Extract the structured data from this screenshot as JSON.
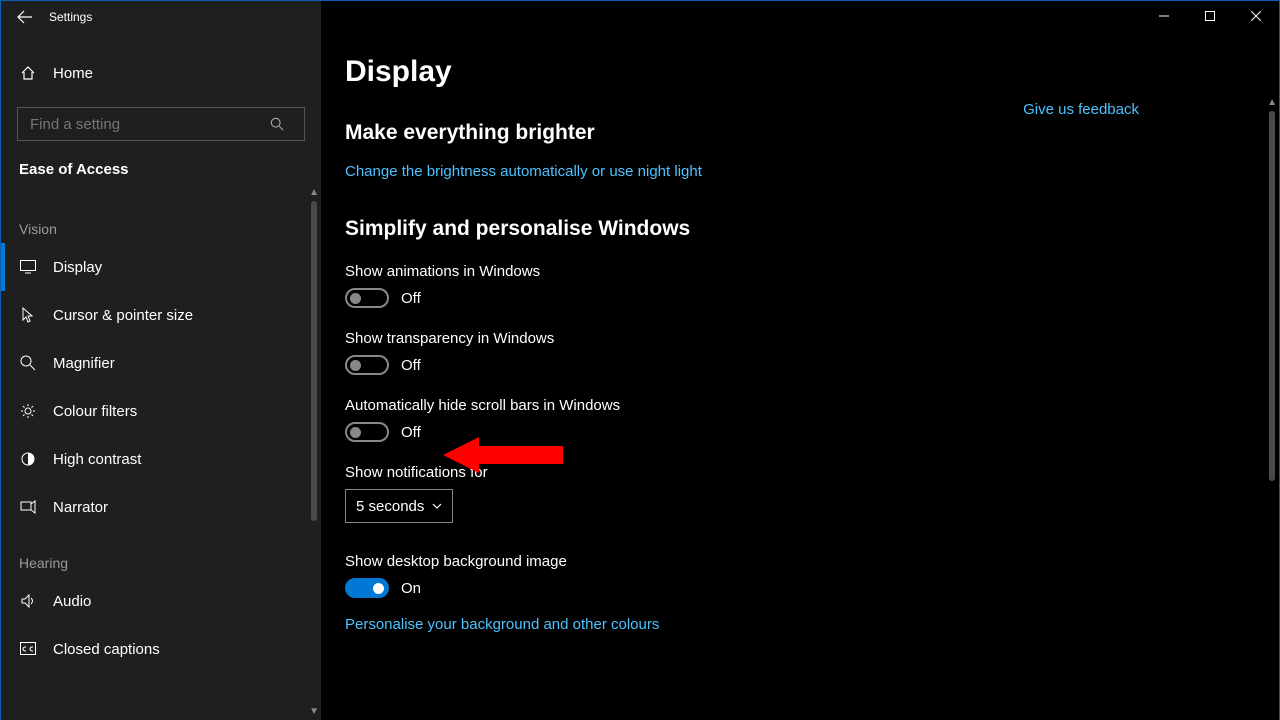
{
  "window": {
    "title": "Settings"
  },
  "sidebar": {
    "home": "Home",
    "search_placeholder": "Find a setting",
    "section": "Ease of Access",
    "groups": [
      {
        "label": "Vision",
        "items": [
          {
            "icon": "display-icon",
            "label": "Display",
            "selected": true
          },
          {
            "icon": "cursor-icon",
            "label": "Cursor & pointer size",
            "selected": false
          },
          {
            "icon": "magnifier-icon",
            "label": "Magnifier",
            "selected": false
          },
          {
            "icon": "colour-filters-icon",
            "label": "Colour filters",
            "selected": false
          },
          {
            "icon": "high-contrast-icon",
            "label": "High contrast",
            "selected": false
          },
          {
            "icon": "narrator-icon",
            "label": "Narrator",
            "selected": false
          }
        ]
      },
      {
        "label": "Hearing",
        "items": [
          {
            "icon": "audio-icon",
            "label": "Audio",
            "selected": false
          },
          {
            "icon": "closed-captions-icon",
            "label": "Closed captions",
            "selected": false
          }
        ]
      }
    ]
  },
  "main": {
    "title": "Display",
    "feedback_link": "Give us feedback",
    "section1": {
      "heading": "Make everything brighter",
      "link": "Change the brightness automatically or use night light"
    },
    "section2": {
      "heading": "Simplify and personalise Windows",
      "toggles": [
        {
          "label": "Show animations in Windows",
          "on": false,
          "state": "Off"
        },
        {
          "label": "Show transparency in Windows",
          "on": false,
          "state": "Off"
        },
        {
          "label": "Automatically hide scroll bars in Windows",
          "on": false,
          "state": "Off"
        }
      ],
      "notifications_label": "Show notifications for",
      "notifications_value": "5 seconds",
      "desktop_bg": {
        "label": "Show desktop background image",
        "on": true,
        "state": "On"
      },
      "personalise_link": "Personalise your background and other colours"
    }
  }
}
